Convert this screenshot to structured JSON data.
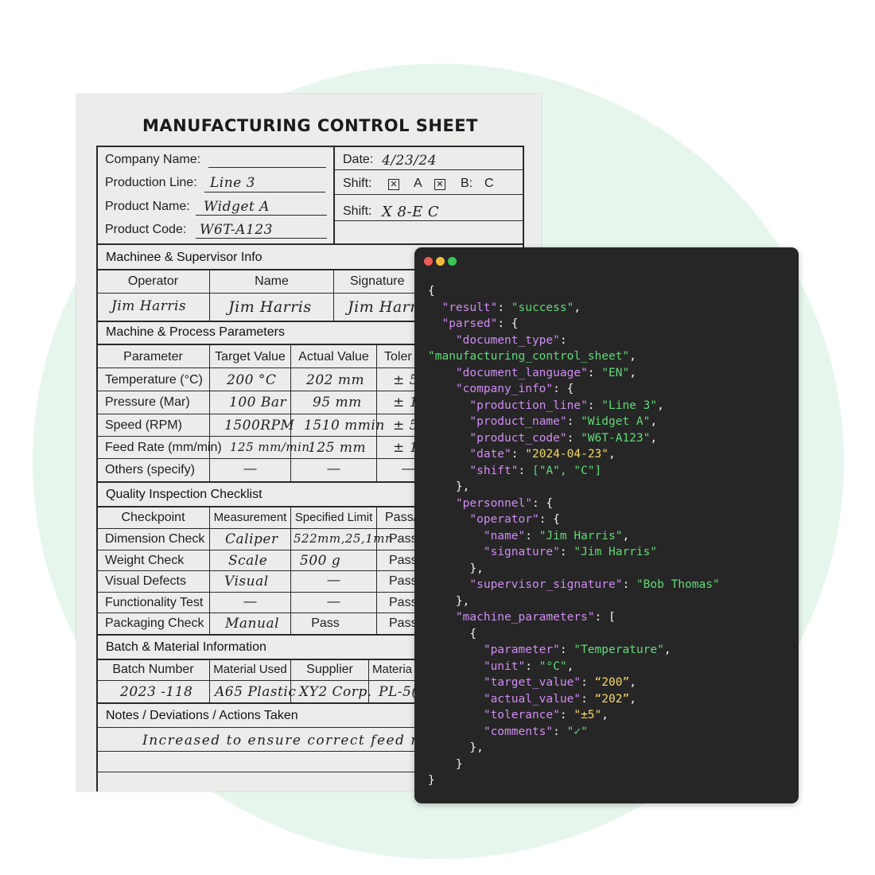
{
  "sheet": {
    "title": "MANUFACTURING CONTROL SHEET",
    "header": {
      "company_label": "Company Name:",
      "line_label": "Production Line:",
      "line_value": "Line 3",
      "product_label": "Product Name:",
      "product_value": "Widget A",
      "code_label": "Product Code:",
      "code_value": "W6T-A123",
      "date_label": "Date:",
      "date_value": "4/23/24",
      "shift_label": "Shift:",
      "shift_a": "A",
      "shift_b": "B:",
      "shift_c": "C",
      "shift2_label": "Shift:",
      "shift2_value": "X   8-E C"
    },
    "personnel": {
      "section": "Machinee & Supervisor Info",
      "col_operator": "Operator",
      "col_name": "Name",
      "col_signature": "Signature",
      "operator": "Jim Harris",
      "name": "Jim Harris",
      "signature": "Jim Harris"
    },
    "machine": {
      "section": "Machine & Process Parameters",
      "headers": [
        "Parameter",
        "Target Value",
        "Actual Value",
        "Toler"
      ],
      "rows": [
        {
          "param": "Temperature (°C)",
          "target": "200 °C",
          "actual": "202 mm",
          "tol": "± 5"
        },
        {
          "param": "Pressure (Mar)",
          "target": "100 Bar",
          "actual": "95 mm",
          "tol": "± 1"
        },
        {
          "param": "Speed (RPM)",
          "target": "1500RPM",
          "actual": "1510 mmin",
          "tol": "± 5"
        },
        {
          "param": "Feed Rate (mm/min)",
          "target": "125 mm/min",
          "actual": "125 mm",
          "tol": "± 1"
        },
        {
          "param": "Others (specify)",
          "target": "—",
          "actual": "—",
          "tol": "—"
        }
      ]
    },
    "quality": {
      "section": "Quality Inspection Checklist",
      "headers": [
        "Checkpoint",
        "Measurement",
        "Specified Limit",
        "Pass/"
      ],
      "rows": [
        {
          "check": "Dimension Check",
          "meas": "Caliper",
          "limit": "522mm,25,1mn",
          "pass": "Pass"
        },
        {
          "check": "Weight Check",
          "meas": "Scale",
          "limit": "500 g",
          "pass": "Pass"
        },
        {
          "check": "Visual Defects",
          "meas": "Visual",
          "limit": "—",
          "pass": "Pass"
        },
        {
          "check": "Functionality Test",
          "meas": "—",
          "limit": "—",
          "pass": "Pass"
        },
        {
          "check": "Packaging Check",
          "meas": "Manual",
          "limit": "Pass",
          "pass": "Pass"
        }
      ]
    },
    "batch": {
      "section": "Batch & Material Information",
      "headers": [
        "Batch Number",
        "Material Used",
        "Supplier",
        "Materia"
      ],
      "row": {
        "batch": "2023 -118",
        "material": "A65 Plastic",
        "supplier": "XY2 Corp.",
        "mat": "PL-5("
      }
    },
    "notes": {
      "section": "Notes / Deviations / Actions Taken",
      "text": "Increased to ensure correct feed rate"
    }
  },
  "code": {
    "brace_open": "{",
    "brace_close": "}",
    "result_key": "\"result\"",
    "result_val": "\"success\"",
    "parsed_key": "\"parsed\"",
    "doc_type_key": "\"document_type\"",
    "doc_type_val": "\"manufacturing_control_sheet\"",
    "doc_lang_key": "\"document_language\"",
    "doc_lang_val": "\"EN\"",
    "company_key": "\"company_info\"",
    "prod_line_key": "\"production_line\"",
    "prod_line_val": "\"Line 3\"",
    "prod_name_key": "\"product_name\"",
    "prod_name_val": "\"Widget A\"",
    "prod_code_key": "\"product_code\"",
    "prod_code_val": "\"W6T-A123\"",
    "date_key": "\"date\"",
    "date_val": "\"2024-04-23\"",
    "shift_key": "\"shift\"",
    "shift_val": "[\"A\", \"C\"]",
    "personnel_key": "\"personnel\"",
    "operator_key": "\"operator\"",
    "name_key": "\"name\"",
    "name_val": "\"Jim Harris\"",
    "sig_key": "\"signature\"",
    "sig_val": "\"Jim Harris\"",
    "sup_key": "\"supervisor_signature\"",
    "sup_val": "\"Bob Thomas\"",
    "mp_key": "\"machine_parameters\"",
    "param_key": "\"parameter\"",
    "param_val": "\"Temperature\"",
    "unit_key": "\"unit\"",
    "unit_val": "\"°C\"",
    "target_key": "\"target_value\"",
    "target_val": "“200”",
    "actual_key": "\"actual_value\"",
    "actual_val": "“202”",
    "tol_key": "\"tolerance\"",
    "tol_val": "\"±5\"",
    "comments_key": "\"comments\"",
    "comments_val": "\"✓\""
  }
}
